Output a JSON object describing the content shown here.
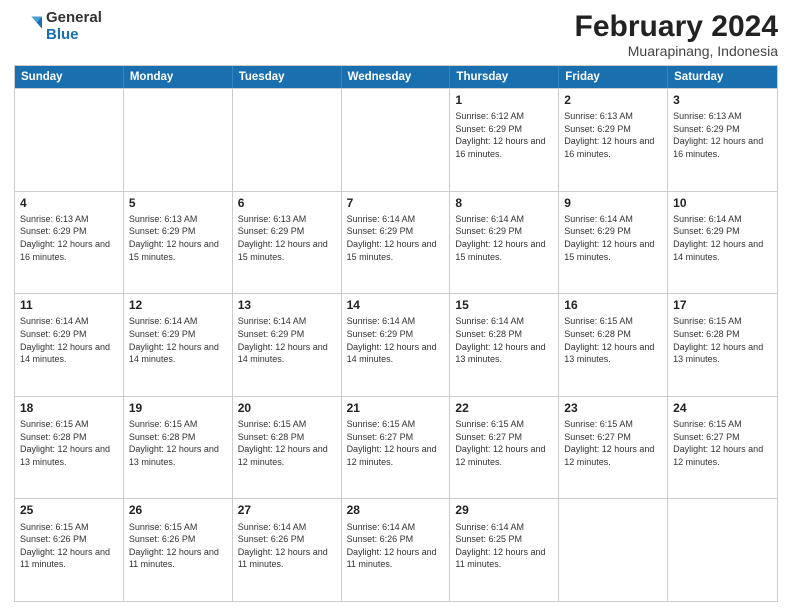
{
  "logo": {
    "general": "General",
    "blue": "Blue"
  },
  "title": "February 2024",
  "subtitle": "Muarapinang, Indonesia",
  "days": [
    "Sunday",
    "Monday",
    "Tuesday",
    "Wednesday",
    "Thursday",
    "Friday",
    "Saturday"
  ],
  "rows": [
    [
      {
        "day": "",
        "info": ""
      },
      {
        "day": "",
        "info": ""
      },
      {
        "day": "",
        "info": ""
      },
      {
        "day": "",
        "info": ""
      },
      {
        "day": "1",
        "info": "Sunrise: 6:12 AM\nSunset: 6:29 PM\nDaylight: 12 hours and 16 minutes."
      },
      {
        "day": "2",
        "info": "Sunrise: 6:13 AM\nSunset: 6:29 PM\nDaylight: 12 hours and 16 minutes."
      },
      {
        "day": "3",
        "info": "Sunrise: 6:13 AM\nSunset: 6:29 PM\nDaylight: 12 hours and 16 minutes."
      }
    ],
    [
      {
        "day": "4",
        "info": "Sunrise: 6:13 AM\nSunset: 6:29 PM\nDaylight: 12 hours and 16 minutes."
      },
      {
        "day": "5",
        "info": "Sunrise: 6:13 AM\nSunset: 6:29 PM\nDaylight: 12 hours and 15 minutes."
      },
      {
        "day": "6",
        "info": "Sunrise: 6:13 AM\nSunset: 6:29 PM\nDaylight: 12 hours and 15 minutes."
      },
      {
        "day": "7",
        "info": "Sunrise: 6:14 AM\nSunset: 6:29 PM\nDaylight: 12 hours and 15 minutes."
      },
      {
        "day": "8",
        "info": "Sunrise: 6:14 AM\nSunset: 6:29 PM\nDaylight: 12 hours and 15 minutes."
      },
      {
        "day": "9",
        "info": "Sunrise: 6:14 AM\nSunset: 6:29 PM\nDaylight: 12 hours and 15 minutes."
      },
      {
        "day": "10",
        "info": "Sunrise: 6:14 AM\nSunset: 6:29 PM\nDaylight: 12 hours and 14 minutes."
      }
    ],
    [
      {
        "day": "11",
        "info": "Sunrise: 6:14 AM\nSunset: 6:29 PM\nDaylight: 12 hours and 14 minutes."
      },
      {
        "day": "12",
        "info": "Sunrise: 6:14 AM\nSunset: 6:29 PM\nDaylight: 12 hours and 14 minutes."
      },
      {
        "day": "13",
        "info": "Sunrise: 6:14 AM\nSunset: 6:29 PM\nDaylight: 12 hours and 14 minutes."
      },
      {
        "day": "14",
        "info": "Sunrise: 6:14 AM\nSunset: 6:29 PM\nDaylight: 12 hours and 14 minutes."
      },
      {
        "day": "15",
        "info": "Sunrise: 6:14 AM\nSunset: 6:28 PM\nDaylight: 12 hours and 13 minutes."
      },
      {
        "day": "16",
        "info": "Sunrise: 6:15 AM\nSunset: 6:28 PM\nDaylight: 12 hours and 13 minutes."
      },
      {
        "day": "17",
        "info": "Sunrise: 6:15 AM\nSunset: 6:28 PM\nDaylight: 12 hours and 13 minutes."
      }
    ],
    [
      {
        "day": "18",
        "info": "Sunrise: 6:15 AM\nSunset: 6:28 PM\nDaylight: 12 hours and 13 minutes."
      },
      {
        "day": "19",
        "info": "Sunrise: 6:15 AM\nSunset: 6:28 PM\nDaylight: 12 hours and 13 minutes."
      },
      {
        "day": "20",
        "info": "Sunrise: 6:15 AM\nSunset: 6:28 PM\nDaylight: 12 hours and 12 minutes."
      },
      {
        "day": "21",
        "info": "Sunrise: 6:15 AM\nSunset: 6:27 PM\nDaylight: 12 hours and 12 minutes."
      },
      {
        "day": "22",
        "info": "Sunrise: 6:15 AM\nSunset: 6:27 PM\nDaylight: 12 hours and 12 minutes."
      },
      {
        "day": "23",
        "info": "Sunrise: 6:15 AM\nSunset: 6:27 PM\nDaylight: 12 hours and 12 minutes."
      },
      {
        "day": "24",
        "info": "Sunrise: 6:15 AM\nSunset: 6:27 PM\nDaylight: 12 hours and 12 minutes."
      }
    ],
    [
      {
        "day": "25",
        "info": "Sunrise: 6:15 AM\nSunset: 6:26 PM\nDaylight: 12 hours and 11 minutes."
      },
      {
        "day": "26",
        "info": "Sunrise: 6:15 AM\nSunset: 6:26 PM\nDaylight: 12 hours and 11 minutes."
      },
      {
        "day": "27",
        "info": "Sunrise: 6:14 AM\nSunset: 6:26 PM\nDaylight: 12 hours and 11 minutes."
      },
      {
        "day": "28",
        "info": "Sunrise: 6:14 AM\nSunset: 6:26 PM\nDaylight: 12 hours and 11 minutes."
      },
      {
        "day": "29",
        "info": "Sunrise: 6:14 AM\nSunset: 6:25 PM\nDaylight: 12 hours and 11 minutes."
      },
      {
        "day": "",
        "info": ""
      },
      {
        "day": "",
        "info": ""
      }
    ]
  ]
}
